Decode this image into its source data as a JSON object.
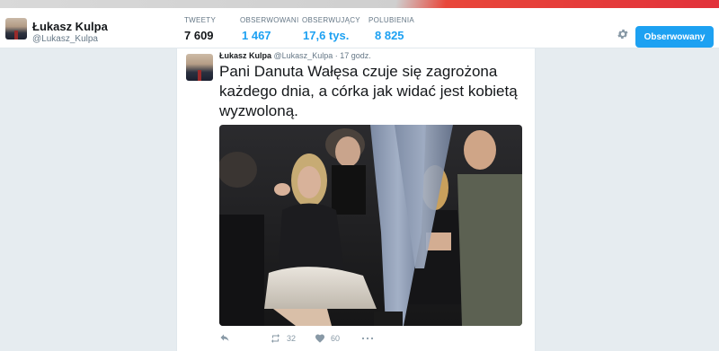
{
  "profile": {
    "name": "Łukasz Kulpa",
    "handle": "@Lukasz_Kulpa"
  },
  "stats": [
    {
      "label": "TWEETY",
      "value": "7 609",
      "active": true
    },
    {
      "label": "OBSERWOWANI",
      "value": "1 467",
      "active": false
    },
    {
      "label": "OBSERWUJĄCY",
      "value": "17,6 tys.",
      "active": false
    },
    {
      "label": "POLUBIENIA",
      "value": "8 825",
      "active": false
    }
  ],
  "toolbar": {
    "gear_icon": "gear-icon",
    "follow_label": "Obserwowany"
  },
  "tweet": {
    "name": "Łukasz Kulpa",
    "handle": "@Lukasz_Kulpa",
    "time": "· 17 godz.",
    "text": "Pani Danuta Wałęsa czuje się zagrożona każdego dnia, a córka jak widać jest kobietą wyzwoloną.",
    "retweets": "32",
    "likes": "60"
  },
  "colors": {
    "accent": "#1da1f2",
    "text": "#14171a",
    "muted": "#657786",
    "background": "#e6ecf0"
  }
}
